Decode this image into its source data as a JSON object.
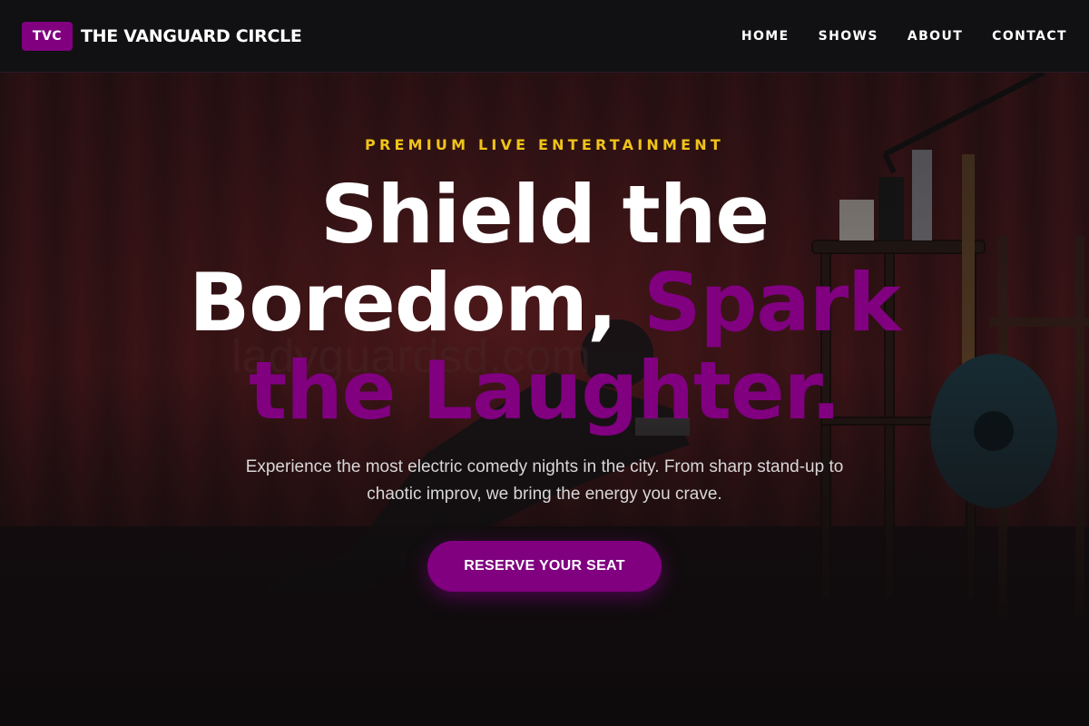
{
  "colors": {
    "accent": "#800080",
    "eyebrow": "#f0c419",
    "background": "#0e0b0d",
    "text": "#ffffff"
  },
  "header": {
    "logo_badge": "TVC",
    "brand_name": "THE VANGUARD CIRCLE",
    "nav": [
      "HOME",
      "SHOWS",
      "ABOUT",
      "CONTACT"
    ]
  },
  "hero": {
    "eyebrow": "PREMIUM LIVE ENTERTAINMENT",
    "headline": {
      "line1": "Shield the",
      "line2_white": "Boredom,",
      "line2_accent": "Spark",
      "line3_accent": "the Laughter."
    },
    "subtext": "Experience the most electric comedy nights in the city. From sharp stand-up to chaotic improv, we bring the energy you crave.",
    "cta_label": "RESERVE YOUR SEAT",
    "background_icon": "comedian-on-stage-photo"
  }
}
